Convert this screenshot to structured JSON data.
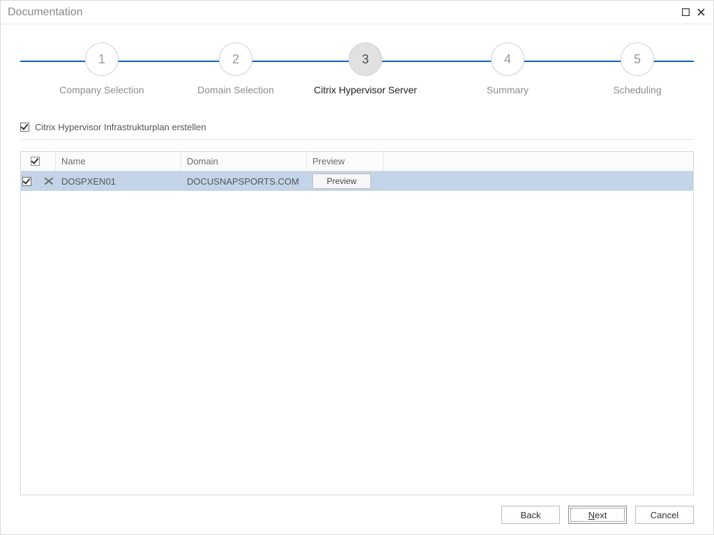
{
  "window": {
    "title": "Documentation"
  },
  "stepper": {
    "steps": [
      {
        "num": "1",
        "label": "Company Selection"
      },
      {
        "num": "2",
        "label": "Domain Selection"
      },
      {
        "num": "3",
        "label": "Citrix Hypervisor Server"
      },
      {
        "num": "4",
        "label": "Summary"
      },
      {
        "num": "5",
        "label": "Scheduling"
      }
    ],
    "active_index": 2
  },
  "option": {
    "label": "Citrix Hypervisor Infrastrukturplan erstellen",
    "checked": true
  },
  "table": {
    "header_checked": true,
    "columns": {
      "name": "Name",
      "domain": "Domain",
      "preview": "Preview"
    },
    "rows": [
      {
        "checked": true,
        "name": "DOSPXEN01",
        "domain": "DOCUSNAPSPORTS.COM",
        "preview_label": "Preview"
      }
    ]
  },
  "footer": {
    "back": "Back",
    "next": "Next",
    "cancel": "Cancel"
  }
}
